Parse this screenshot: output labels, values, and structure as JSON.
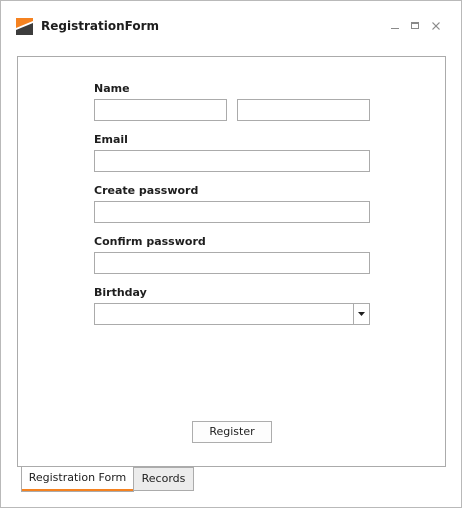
{
  "window": {
    "title": "RegistrationForm",
    "logo_icon": "app-logo-icon",
    "controls": {
      "minimize_icon": "minimize-icon",
      "maximize_icon": "maximize-icon",
      "close_icon": "close-icon"
    },
    "accent_color": "#f58220"
  },
  "form": {
    "name_label": "Name",
    "first_name_value": "",
    "last_name_value": "",
    "email_label": "Email",
    "email_value": "",
    "create_password_label": "Create password",
    "create_password_value": "",
    "confirm_password_label": "Confirm password",
    "confirm_password_value": "",
    "birthday_label": "Birthday",
    "birthday_value": "",
    "register_label": "Register"
  },
  "tabs": [
    {
      "label": "Registration Form",
      "selected": true
    },
    {
      "label": "Records",
      "selected": false
    }
  ]
}
